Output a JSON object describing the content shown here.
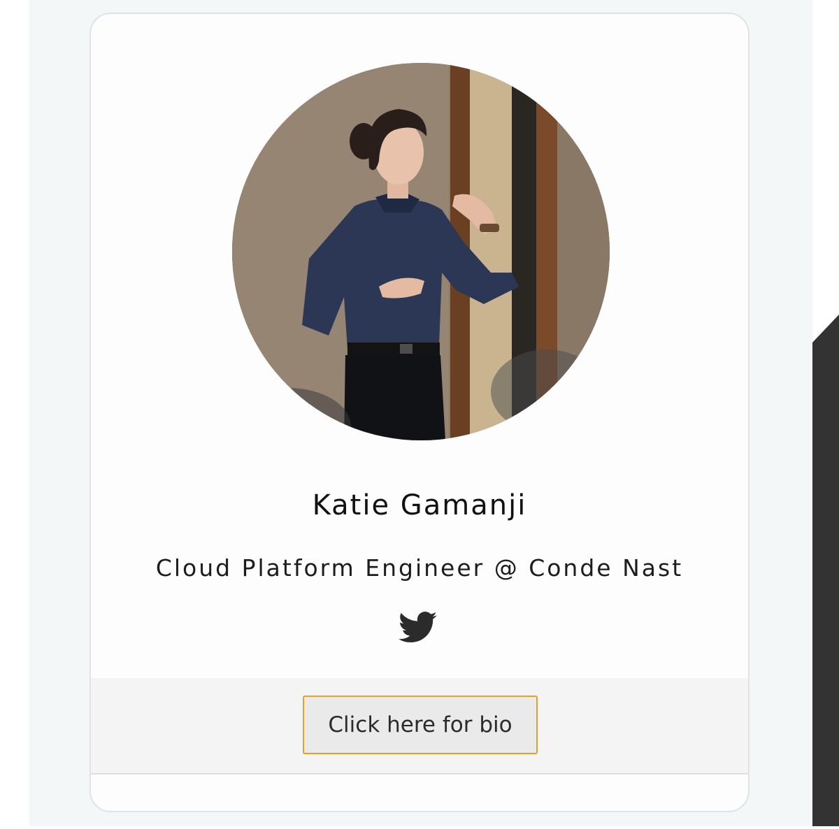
{
  "speaker": {
    "name": "Katie Gamanji",
    "title": "Cloud Platform Engineer @ Conde Nast",
    "photo_icon": "speaker-photo",
    "social": {
      "twitter_icon": "twitter-icon"
    }
  },
  "footer": {
    "bio_button_label": "Click here for bio"
  },
  "colors": {
    "page_background": "#f4f7f7",
    "card_background": "#fdfdfd",
    "card_border": "#dfe3e6",
    "button_border": "#e0a22b",
    "button_background": "#eaeaea",
    "footer_background": "#f4f4f4",
    "twitter_icon": "#2b2b2b",
    "scroll_element": "#333333"
  }
}
